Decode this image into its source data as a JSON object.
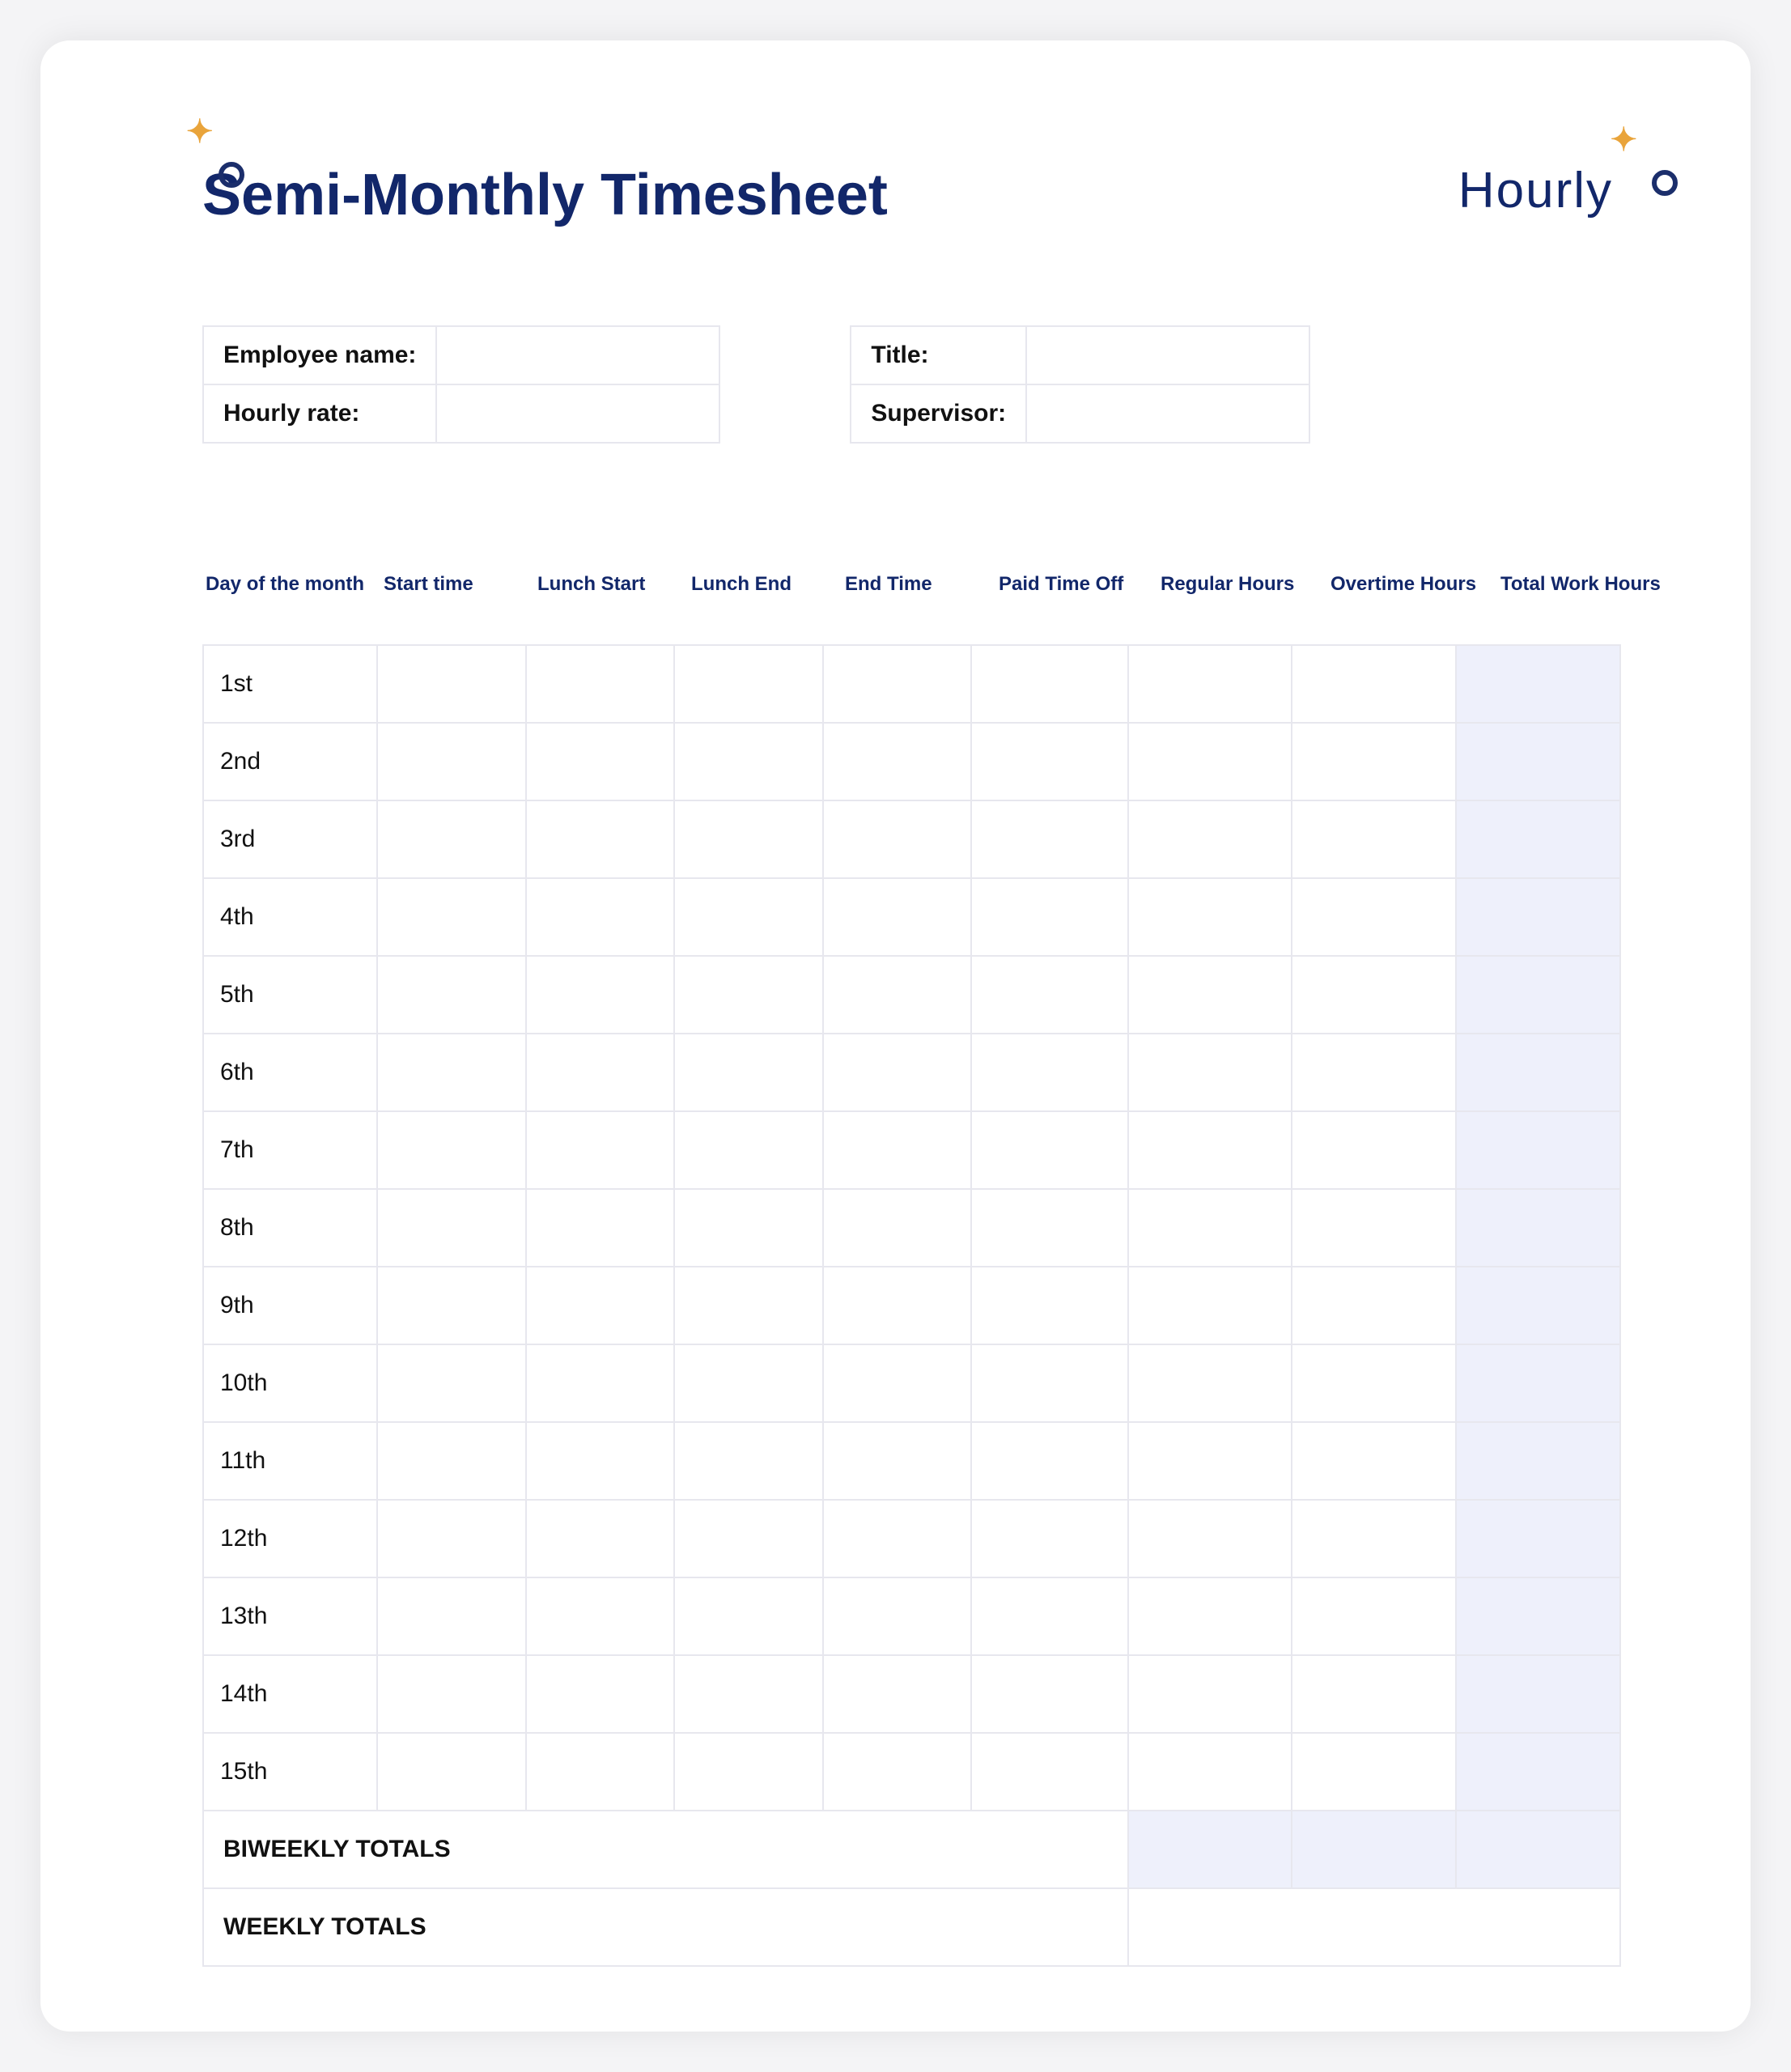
{
  "title": "Semi-Monthly Timesheet",
  "brand": "Hourly",
  "info": {
    "left": [
      {
        "label": "Employee name:",
        "value": ""
      },
      {
        "label": "Hourly rate:",
        "value": ""
      }
    ],
    "right": [
      {
        "label": "Title:",
        "value": ""
      },
      {
        "label": "Supervisor:",
        "value": ""
      }
    ]
  },
  "columns": [
    "Day of the month",
    "Start time",
    "Lunch Start",
    "Lunch End",
    "End Time",
    "Paid Time Off",
    "Regular Hours",
    "Overtime Hours",
    "Total Work Hours"
  ],
  "rows": [
    {
      "day": "1st",
      "start": "",
      "lunch_start": "",
      "lunch_end": "",
      "end": "",
      "pto": "",
      "regular": "",
      "overtime": "",
      "total": ""
    },
    {
      "day": "2nd",
      "start": "",
      "lunch_start": "",
      "lunch_end": "",
      "end": "",
      "pto": "",
      "regular": "",
      "overtime": "",
      "total": ""
    },
    {
      "day": "3rd",
      "start": "",
      "lunch_start": "",
      "lunch_end": "",
      "end": "",
      "pto": "",
      "regular": "",
      "overtime": "",
      "total": ""
    },
    {
      "day": "4th",
      "start": "",
      "lunch_start": "",
      "lunch_end": "",
      "end": "",
      "pto": "",
      "regular": "",
      "overtime": "",
      "total": ""
    },
    {
      "day": "5th",
      "start": "",
      "lunch_start": "",
      "lunch_end": "",
      "end": "",
      "pto": "",
      "regular": "",
      "overtime": "",
      "total": ""
    },
    {
      "day": "6th",
      "start": "",
      "lunch_start": "",
      "lunch_end": "",
      "end": "",
      "pto": "",
      "regular": "",
      "overtime": "",
      "total": ""
    },
    {
      "day": "7th",
      "start": "",
      "lunch_start": "",
      "lunch_end": "",
      "end": "",
      "pto": "",
      "regular": "",
      "overtime": "",
      "total": ""
    },
    {
      "day": "8th",
      "start": "",
      "lunch_start": "",
      "lunch_end": "",
      "end": "",
      "pto": "",
      "regular": "",
      "overtime": "",
      "total": ""
    },
    {
      "day": "9th",
      "start": "",
      "lunch_start": "",
      "lunch_end": "",
      "end": "",
      "pto": "",
      "regular": "",
      "overtime": "",
      "total": ""
    },
    {
      "day": "10th",
      "start": "",
      "lunch_start": "",
      "lunch_end": "",
      "end": "",
      "pto": "",
      "regular": "",
      "overtime": "",
      "total": ""
    },
    {
      "day": "11th",
      "start": "",
      "lunch_start": "",
      "lunch_end": "",
      "end": "",
      "pto": "",
      "regular": "",
      "overtime": "",
      "total": ""
    },
    {
      "day": "12th",
      "start": "",
      "lunch_start": "",
      "lunch_end": "",
      "end": "",
      "pto": "",
      "regular": "",
      "overtime": "",
      "total": ""
    },
    {
      "day": "13th",
      "start": "",
      "lunch_start": "",
      "lunch_end": "",
      "end": "",
      "pto": "",
      "regular": "",
      "overtime": "",
      "total": ""
    },
    {
      "day": "14th",
      "start": "",
      "lunch_start": "",
      "lunch_end": "",
      "end": "",
      "pto": "",
      "regular": "",
      "overtime": "",
      "total": ""
    },
    {
      "day": "15th",
      "start": "",
      "lunch_start": "",
      "lunch_end": "",
      "end": "",
      "pto": "",
      "regular": "",
      "overtime": "",
      "total": ""
    }
  ],
  "totals": {
    "biweekly_label": "BIWEEKLY TOTALS",
    "biweekly": {
      "regular": "",
      "overtime": "",
      "total": ""
    },
    "weekly_label": "WEEKLY TOTALS",
    "weekly": {
      "combined": ""
    }
  }
}
